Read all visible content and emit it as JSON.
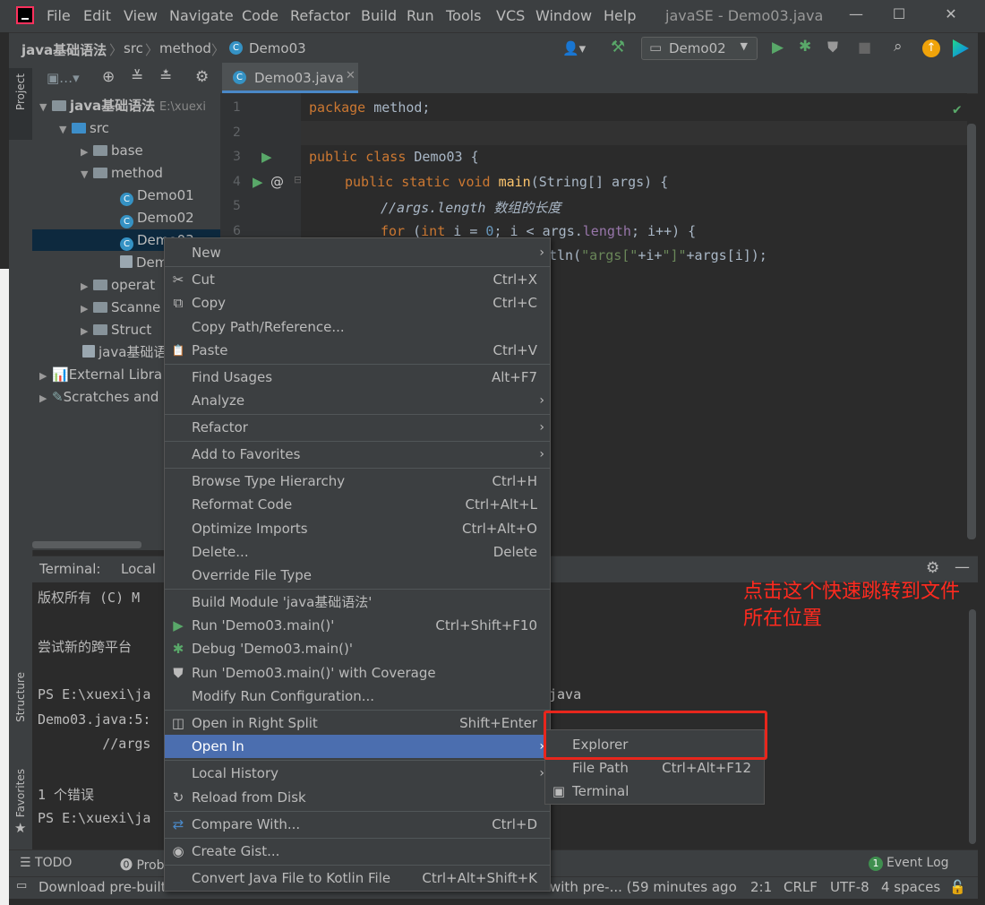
{
  "window": {
    "title": "javaSE - Demo03.java",
    "menu": [
      "File",
      "Edit",
      "View",
      "Navigate",
      "Code",
      "Refactor",
      "Build",
      "Run",
      "Tools",
      "VCS",
      "Window",
      "Help"
    ],
    "controls": [
      "—",
      "☐",
      "✕"
    ]
  },
  "navbar": {
    "breadcrumbs": [
      "java基础语法",
      "src",
      "method",
      "Demo03"
    ],
    "run_config": "Demo02"
  },
  "left_stripe": {
    "project": "Project",
    "structure": "Structure",
    "favorites": "Favorites"
  },
  "project_tree": {
    "root_label": "java基础语法",
    "root_path": "E:\\xuexi",
    "items": [
      {
        "label": "src"
      },
      {
        "label": "base"
      },
      {
        "label": "method"
      },
      {
        "label": "Demo01"
      },
      {
        "label": "Demo02"
      },
      {
        "label": "Demo03"
      },
      {
        "label": "Dem"
      },
      {
        "label": "operat"
      },
      {
        "label": "Scanne"
      },
      {
        "label": "Struct"
      },
      {
        "label": "java基础语"
      },
      {
        "label": "External Libra"
      },
      {
        "label": "Scratches and"
      }
    ]
  },
  "editor": {
    "tab": "Demo03.java",
    "line_numbers": [
      "1",
      "2",
      "3",
      "4",
      "5",
      "6"
    ],
    "lines": {
      "l1a": "package",
      "l1b": " method;",
      "l3a": "public class",
      "l3b": " Demo03 {",
      "l4a": "public static void",
      "l4b": " main",
      "l4c": "(String[] args) {",
      "l5": "//args.length 数组的长度",
      "l6a": "for",
      "l6b": " (",
      "l6c": "int",
      "l6d": " i = ",
      "l6e": "0",
      "l6f": "; i < args.",
      "l6g": "length",
      "l6h": "; i++) {",
      "l7a": "tln(",
      "l7b": "\"args[\"",
      "l7c": "+i+",
      "l7d": "\"]\"",
      "l7e": "+args[i]);"
    }
  },
  "terminal": {
    "header": "Terminal:",
    "tab": "Local",
    "lines": [
      "版权所有 (C) M",
      "尝试新的跨平台",
      "PS E:\\xuexi\\ja",
      "Demo03.java:5:",
      "        //args",
      "1 个错误",
      "PS E:\\xuexi\\ja"
    ],
    "tail_java": "java"
  },
  "context_menu": {
    "items": [
      {
        "label": "New",
        "submenu": true
      },
      {
        "label": "Cut",
        "shortcut": "Ctrl+X",
        "icon": "✂"
      },
      {
        "label": "Copy",
        "shortcut": "Ctrl+C",
        "icon": "⧉"
      },
      {
        "label": "Copy Path/Reference..."
      },
      {
        "label": "Paste",
        "shortcut": "Ctrl+V",
        "icon": "📋"
      },
      {
        "label": "Find Usages",
        "shortcut": "Alt+F7"
      },
      {
        "label": "Analyze",
        "submenu": true
      },
      {
        "label": "Refactor",
        "submenu": true
      },
      {
        "label": "Add to Favorites",
        "submenu": true
      },
      {
        "label": "Browse Type Hierarchy",
        "shortcut": "Ctrl+H"
      },
      {
        "label": "Reformat Code",
        "shortcut": "Ctrl+Alt+L"
      },
      {
        "label": "Optimize Imports",
        "shortcut": "Ctrl+Alt+O"
      },
      {
        "label": "Delete...",
        "shortcut": "Delete"
      },
      {
        "label": "Override File Type"
      },
      {
        "label": "Build Module 'java基础语法'"
      },
      {
        "label": "Run 'Demo03.main()'",
        "shortcut": "Ctrl+Shift+F10"
      },
      {
        "label": "Debug 'Demo03.main()'"
      },
      {
        "label": "Run 'Demo03.main()' with Coverage"
      },
      {
        "label": "Modify Run Configuration..."
      },
      {
        "label": "Open in Right Split",
        "shortcut": "Shift+Enter"
      },
      {
        "label": "Open In",
        "submenu": true
      },
      {
        "label": "Local History",
        "submenu": true
      },
      {
        "label": "Reload from Disk"
      },
      {
        "label": "Compare With...",
        "shortcut": "Ctrl+D"
      },
      {
        "label": "Create Gist..."
      },
      {
        "label": "Convert Java File to Kotlin File",
        "shortcut": "Ctrl+Alt+Shift+K"
      }
    ]
  },
  "submenu": {
    "items": [
      {
        "label": "Explorer"
      },
      {
        "label": "File Path",
        "shortcut": "Ctrl+Alt+F12"
      },
      {
        "label": "Terminal"
      }
    ]
  },
  "annotation": "点击这个快速跳转到文件所在位置",
  "toolstrip": {
    "todo": "TODO",
    "problems": "Prob",
    "event_count": "1",
    "event_log": "Event Log"
  },
  "statusbar": {
    "message_start": "Download pre-built",
    "message_end": "with pre-... (59 minutes ago",
    "position": "2:1",
    "line_sep": "CRLF",
    "encoding": "UTF-8",
    "indent": "4 spaces"
  },
  "colors": {
    "accent": "#4b6eaf",
    "annotation_red": "#e8261c",
    "keyword": "#cc7832",
    "function": "#ffc66d",
    "string": "#6a8759"
  }
}
